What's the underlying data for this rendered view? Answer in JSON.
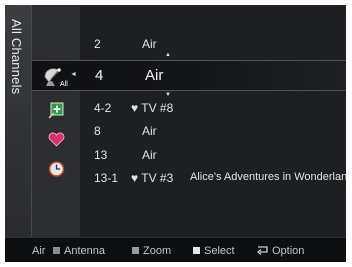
{
  "side_tab": {
    "label": "All Channels"
  },
  "channel_list": {
    "above": {
      "number": "2",
      "channel": "Air"
    },
    "selected": {
      "number": "4",
      "channel": "Air"
    },
    "below": [
      {
        "number": "4-2",
        "channel": "♥ TV #8",
        "program": ""
      },
      {
        "number": "8",
        "channel": "Air",
        "program": ""
      },
      {
        "number": "13",
        "channel": "Air",
        "program": ""
      },
      {
        "number": "13-1",
        "channel": "♥ TV #3",
        "program": "Alice's Adventures in Wonderland"
      }
    ]
  },
  "icons": {
    "all": {
      "name": "all-channels-icon",
      "label": "All"
    },
    "added": {
      "name": "added-channels-icon"
    },
    "favorite": {
      "name": "favorite-icon"
    },
    "timer": {
      "name": "timer-icon"
    }
  },
  "legend": {
    "source": "Air",
    "antenna": "Antenna",
    "zoom": "Zoom",
    "select": "Select",
    "option": "Option"
  },
  "colors": {
    "antenna_key": "#8c8c8c",
    "zoom_key": "#9a9a9a",
    "select_key": "#e6e6e6",
    "background": "#1b1c1e"
  }
}
